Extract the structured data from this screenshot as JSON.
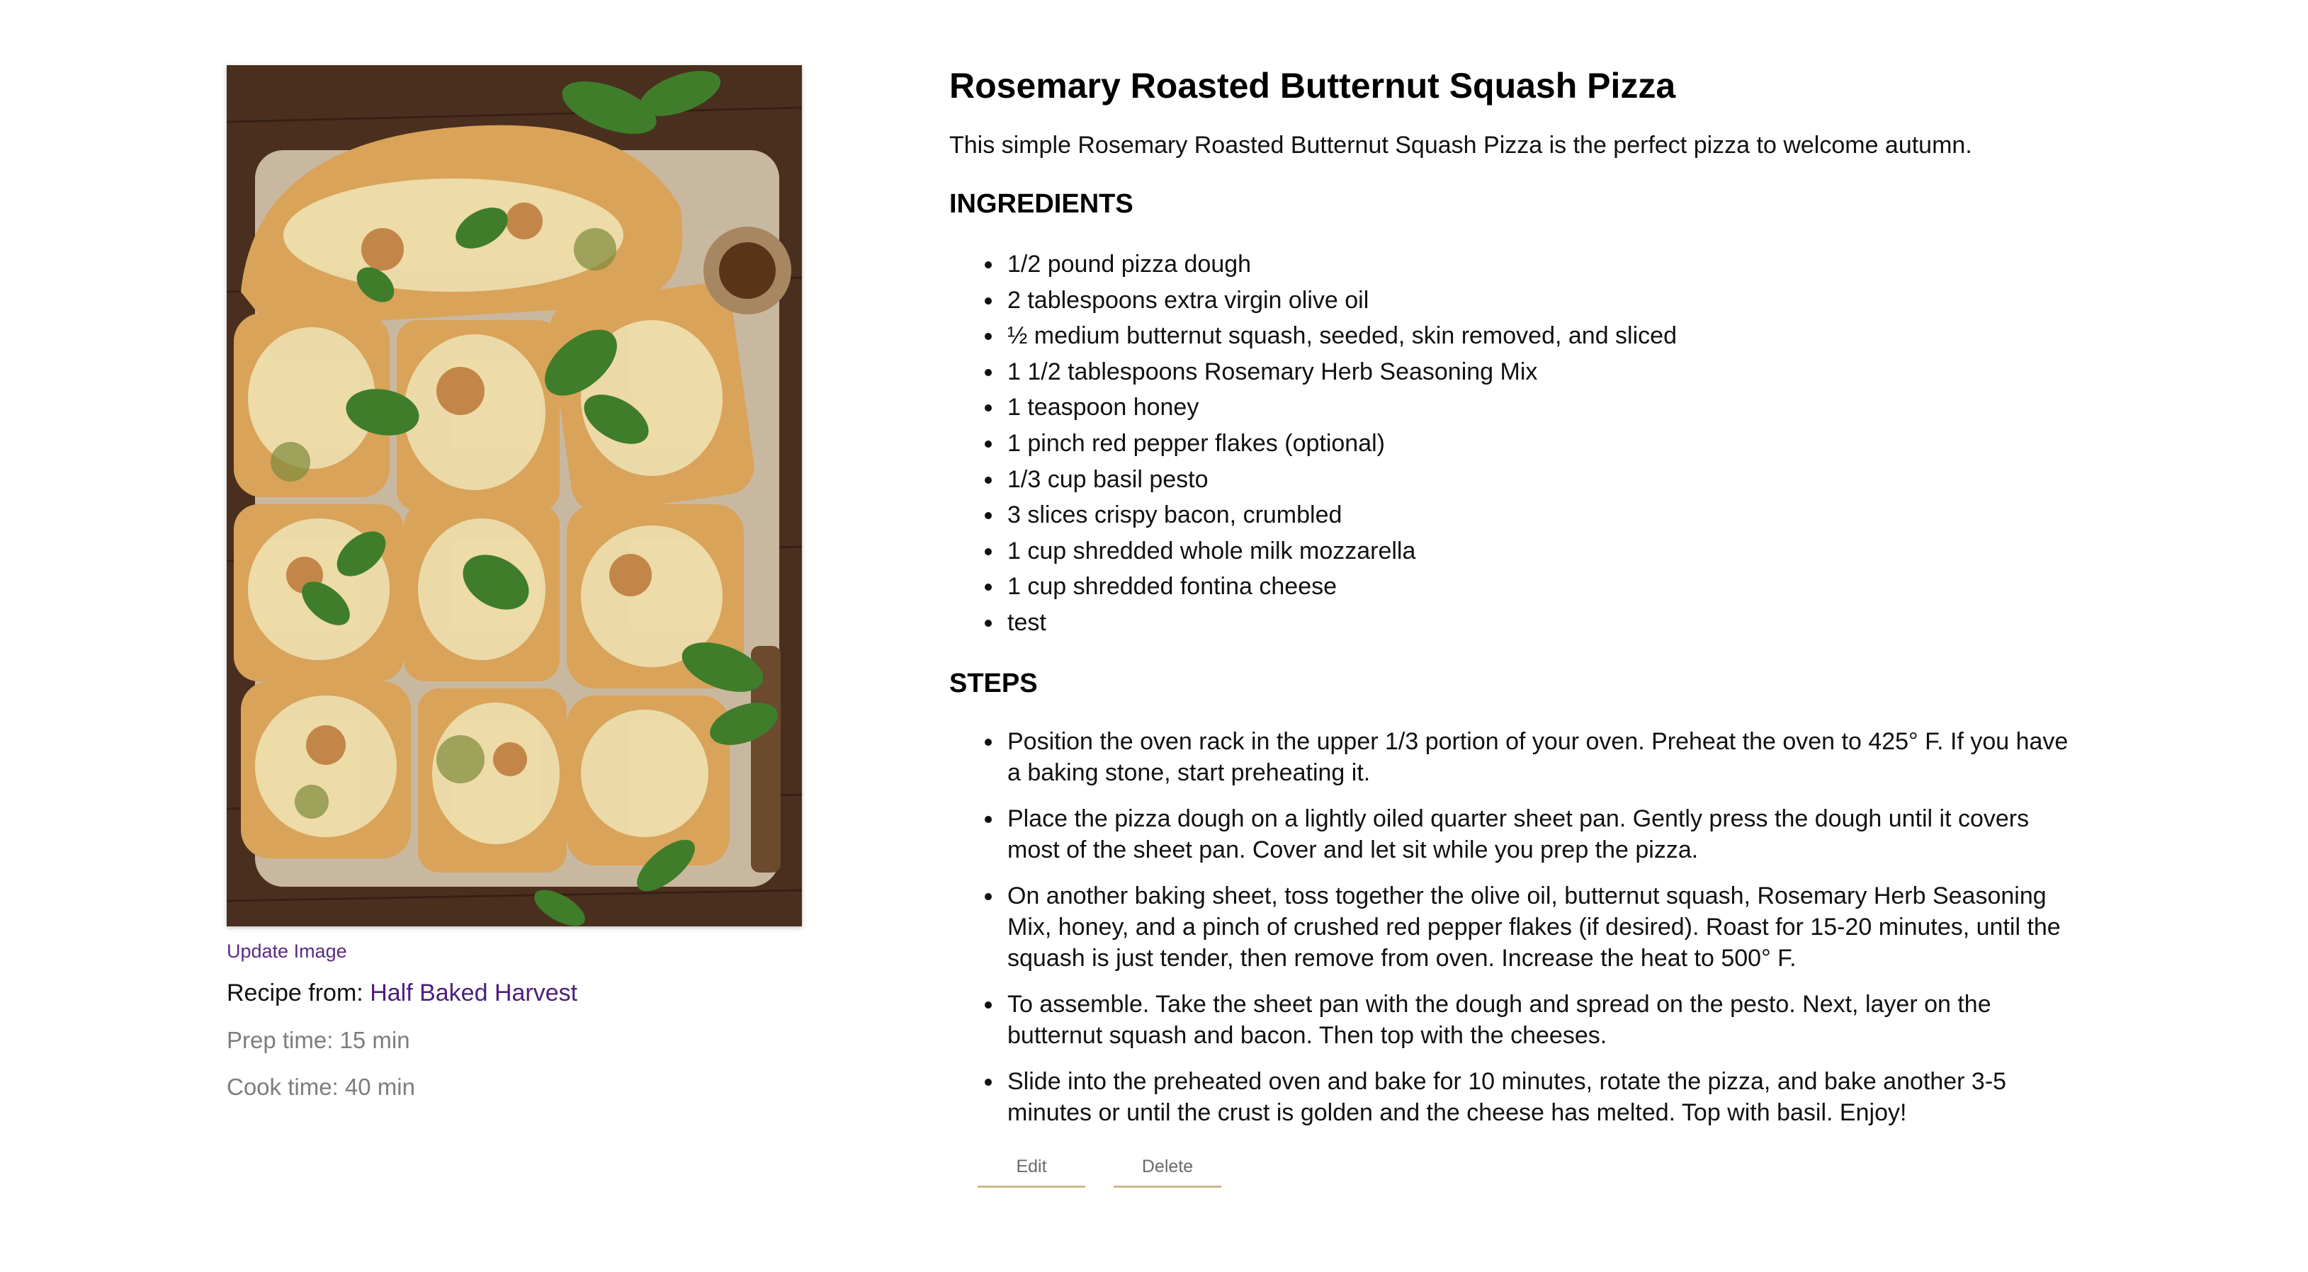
{
  "recipe": {
    "title": "Rosemary Roasted Butternut Squash Pizza",
    "description": "This simple Rosemary Roasted Butternut Squash Pizza is the perfect pizza to welcome autumn.",
    "update_image_label": "Update Image",
    "source_prefix": "Recipe from: ",
    "source_name": "Half Baked Harvest",
    "prep_time": "Prep time: 15 min",
    "cook_time": "Cook time: 40 min",
    "ingredients_heading": "INGREDIENTS",
    "ingredients": [
      "1/2 pound pizza dough",
      "2 tablespoons extra virgin olive oil",
      "½ medium butternut squash, seeded, skin removed, and sliced",
      "1 1/2 tablespoons Rosemary Herb Seasoning Mix",
      "1 teaspoon honey",
      "1 pinch red pepper flakes (optional)",
      "1/3 cup basil pesto",
      "3 slices crispy bacon, crumbled",
      "1 cup shredded whole milk mozzarella",
      "1 cup shredded fontina cheese",
      "test"
    ],
    "steps_heading": "STEPS",
    "steps": [
      "Position the oven rack in the upper 1/3 portion of your oven. Preheat the oven to 425° F. If you have a baking stone, start preheating it.",
      "Place the pizza dough on a lightly oiled quarter sheet pan. Gently press the dough until it covers most of the sheet pan. Cover and let sit while you prep the pizza.",
      "On another baking sheet, toss together the olive oil, butternut squash, Rosemary Herb Seasoning Mix, honey, and a pinch of crushed red pepper flakes (if desired). Roast for 15-20 minutes, until the squash is just tender, then remove from oven. Increase the heat to 500° F.",
      "To assemble. Take the sheet pan with the dough and spread on the pesto. Next, layer on the butternut squash and bacon. Then top with the cheeses.",
      "Slide into the preheated oven and bake for 10 minutes, rotate the pizza, and bake another 3-5 minutes or until the crust is golden and the cheese has melted. Top with basil. Enjoy!"
    ]
  },
  "actions": {
    "edit_label": "Edit",
    "delete_label": "Delete"
  },
  "colors": {
    "link": "#5b2a86",
    "muted_text": "#7d7d7d",
    "button_underline": "#cdb888"
  }
}
